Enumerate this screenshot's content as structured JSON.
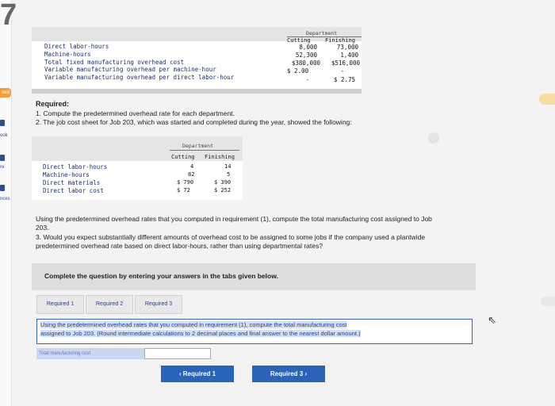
{
  "left_nav": {
    "badge": "sed",
    "items": [
      "ook",
      "re",
      "nces"
    ]
  },
  "table1": {
    "dept_header": "Department",
    "col_cutting": "Cutting",
    "col_finishing": "Finishing",
    "rows": [
      {
        "label": "Direct labor-hours",
        "cutting": "8,000",
        "finishing": "73,000"
      },
      {
        "label": "Machine-hours",
        "cutting": "52,300",
        "finishing": "1,400"
      },
      {
        "label": "Total fixed manufacturing overhead cost",
        "cutting": "$380,000",
        "finishing": "$516,000"
      },
      {
        "label": "Variable manufacturing overhead per machine-hour",
        "cutting": "$  2.00",
        "finishing": "-"
      },
      {
        "label": "Variable manufacturing overhead per direct labor-hour",
        "cutting": "-",
        "finishing": "$   2.75"
      }
    ]
  },
  "required": {
    "heading": "Required:",
    "line1": "1. Compute the predetermined overhead rate for each department.",
    "line2": "2. The job cost sheet for Job 203, which was started and completed during the year, showed the following:"
  },
  "table2": {
    "dept_header": "Department",
    "col_cutting": "Cutting",
    "col_finishing": "Finishing",
    "rows": [
      {
        "label": "Direct labor-hours",
        "cutting": "4",
        "finishing": "14"
      },
      {
        "label": "Machine-hours",
        "cutting": "82",
        "finishing": "5"
      },
      {
        "label": "Direct materials",
        "cutting": "$ 790",
        "finishing": "$ 390"
      },
      {
        "label": "Direct labor cost",
        "cutting": "$ 72",
        "finishing": "$ 252"
      }
    ]
  },
  "question": {
    "line1": "Using the predetermined overhead rates that you computed in requirement (1), compute the total manufacturing cost assigned to Job",
    "line2": "203.",
    "line3": "3. Would you expect substantially different amounts of overhead cost to be assigned to some jobs if the company used a plantwide",
    "line4": "predetermined overhead rate based on direct labor-hours, rather than using departmental rates?"
  },
  "instructions": "Complete the question by entering your answers in the tabs given below.",
  "tabs": [
    {
      "label": "Required 1"
    },
    {
      "label": "Required 2"
    },
    {
      "label": "Required 3"
    }
  ],
  "answer": {
    "prompt_line1": "Using the predetermined overhead rates that you computed in requirement (1), compute the total manufacturing cost",
    "prompt_line2": "assigned to Job 203. (Round intermediate calculations to 2 decimal places and final answer to the nearest dollar amount.)",
    "field_label": "Total manufacturing cost",
    "field_value": ""
  },
  "nav": {
    "prev_label": "‹  Required 1",
    "next_label": "Required 3  ›"
  }
}
